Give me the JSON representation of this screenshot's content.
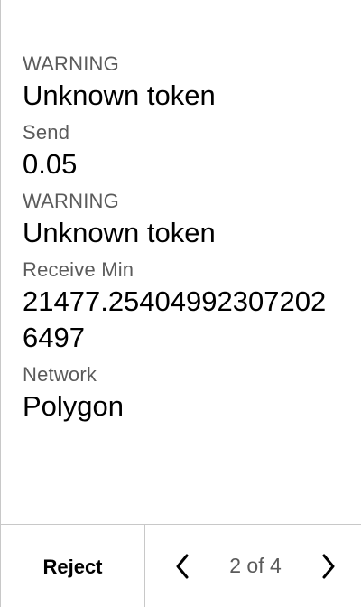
{
  "fields": [
    {
      "label": "WARNING",
      "value": "Unknown token"
    },
    {
      "label": "Send",
      "value": "0.05"
    },
    {
      "label": "WARNING",
      "value": "Unknown token"
    },
    {
      "label": "Receive Min",
      "value": "21477.254049923072026497"
    },
    {
      "label": "Network",
      "value": "Polygon"
    }
  ],
  "footer": {
    "reject_label": "Reject",
    "pager_text": "2 of 4",
    "prev_icon": "chevron-left-icon",
    "next_icon": "chevron-right-icon"
  },
  "colors": {
    "label": "#5b5b5b",
    "value": "#000000",
    "divider": "#c8c8c8",
    "background": "#ffffff"
  }
}
